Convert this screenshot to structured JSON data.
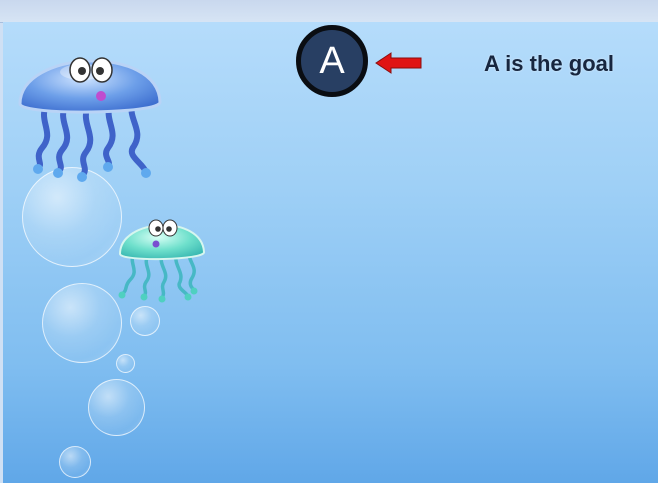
{
  "goal": {
    "marker_letter": "A",
    "caption": "A is the goal"
  },
  "icons": {
    "arrow": "left-arrow-icon",
    "creatures": [
      "jellyfish-icon",
      "jellyfish-icon"
    ]
  },
  "colors": {
    "marker_fill": "#283f63",
    "marker_border": "#0a0d12",
    "arrow": "#e01414",
    "background_top": "#b5dcfb",
    "background_bottom": "#60a7e8",
    "caption_text": "#17263f"
  }
}
